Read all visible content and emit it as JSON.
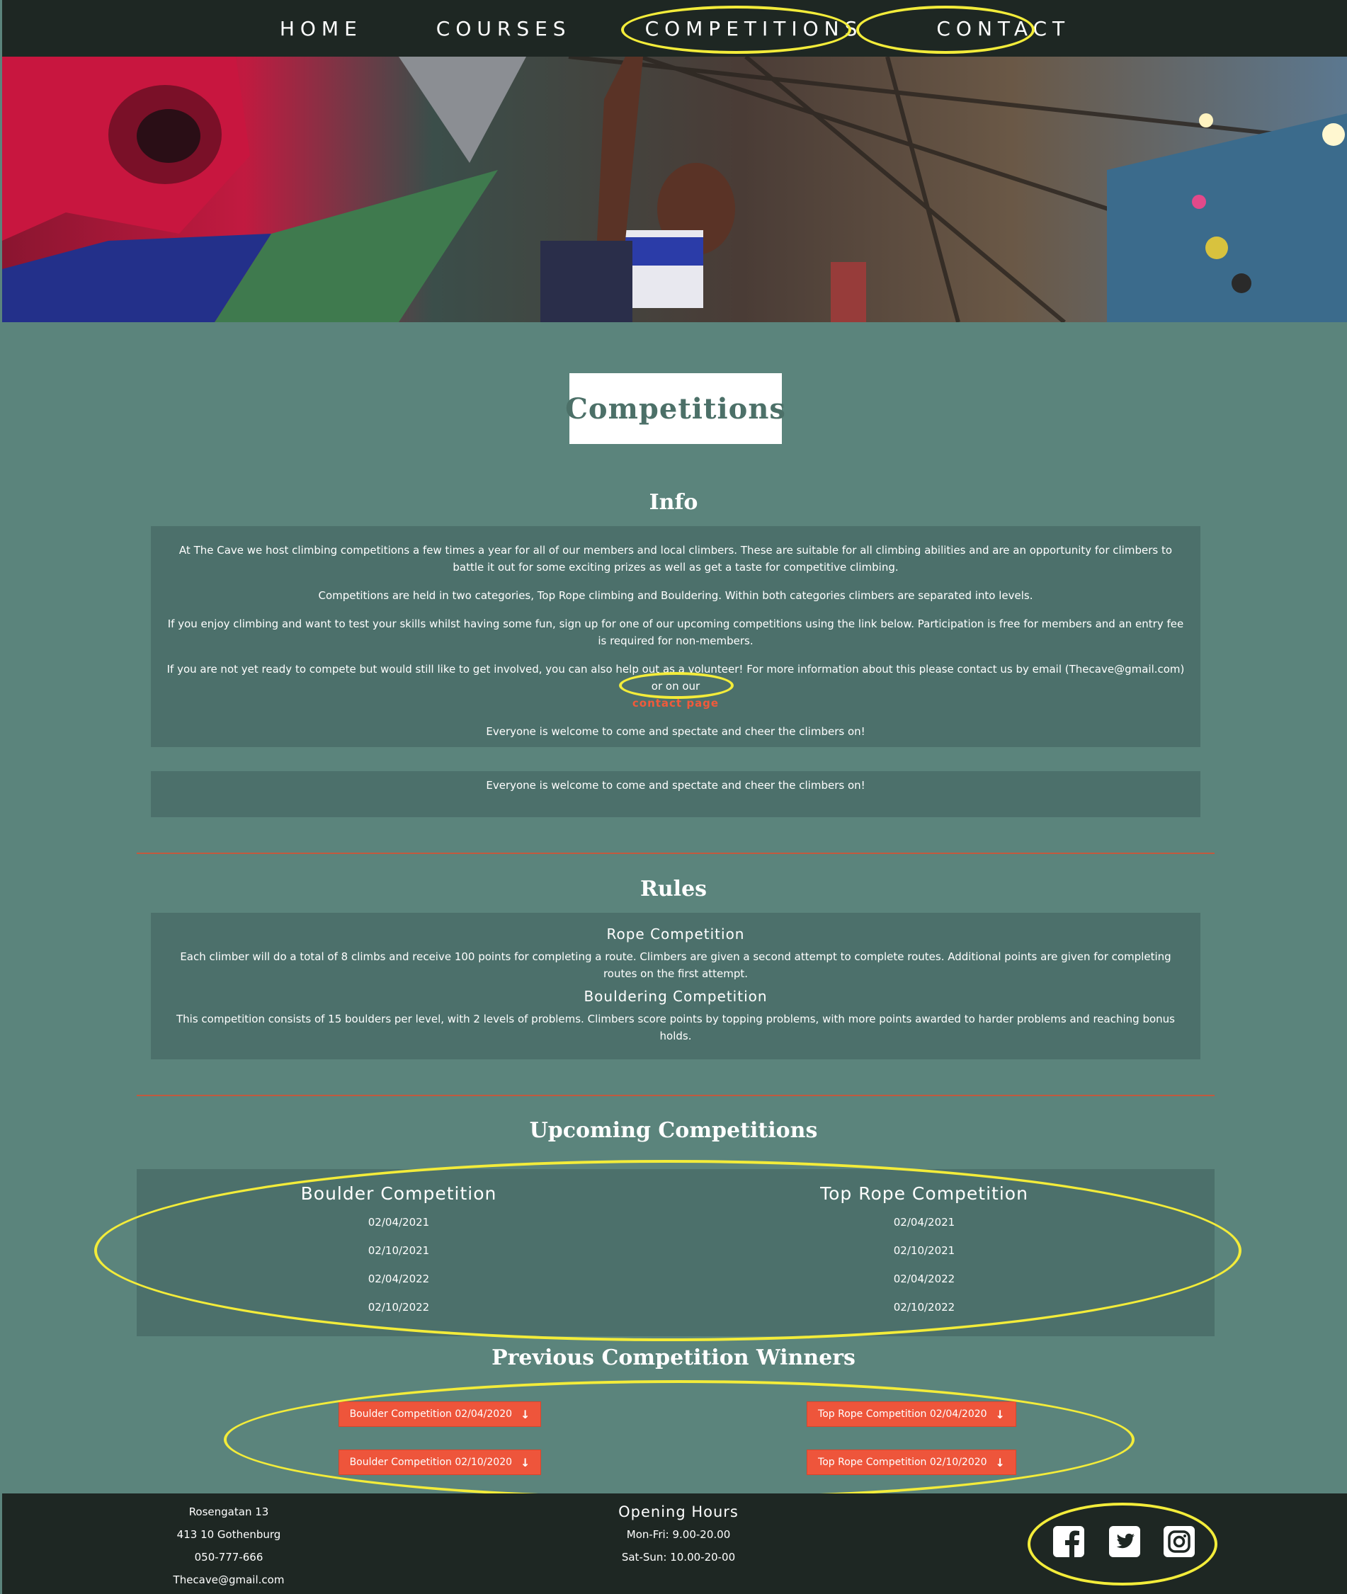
{
  "nav": {
    "items": [
      "HOME",
      "COURSES",
      "COMPETITIONS",
      "CONTACT"
    ]
  },
  "main": {
    "title": "Competitions",
    "info": {
      "heading": "Info",
      "p1": "At The Cave we host climbing competitions a few times a year for all of our members and local climbers. These are suitable for all climbing abilities and are an opportunity for climbers to battle it out for some exciting prizes as well as get a taste for competitive climbing.",
      "p2": "Competitions are held in two categories, Top Rope climbing and Bouldering. Within both categories climbers are separated into levels.",
      "p3": "If you enjoy climbing and want to test your skills whilst having some fun, sign up for one of our upcoming competitions using the link below. Participation is free for members and an entry fee is required for non-members.",
      "p4": "If you are not yet ready to compete but would still like to get involved, you can also help out as a volunteer! For more information about this please contact us by email (Thecave@gmail.com) or on our",
      "contact_link": "contact page",
      "p5": "Everyone is welcome to come and spectate and cheer the climbers on!",
      "extra": "Everyone is welcome to come and spectate and cheer the climbers on!"
    },
    "rules": {
      "heading": "Rules",
      "rope_title": "Rope Competition",
      "rope_text": "Each climber will do a total of 8 climbs and receive 100 points for completing a route. Climbers are given a second attempt to complete routes. Additional points are given for completing routes on the first attempt.",
      "boulder_title": "Bouldering Competition",
      "boulder_text": "This competition consists of 15 boulders per level, with 2 levels of problems. Climbers score points by topping problems, with more points awarded to harder problems and reaching bonus holds."
    },
    "upcoming": {
      "heading": "Upcoming Competitions",
      "boulder_title": "Boulder Competition",
      "boulder_dates": [
        "02/04/2021",
        "02/10/2021",
        "02/04/2022",
        "02/10/2022"
      ],
      "rope_title": "Top Rope Competition",
      "rope_dates": [
        "02/04/2021",
        "02/10/2021",
        "02/04/2022",
        "02/10/2022"
      ]
    },
    "winners": {
      "heading": "Previous Competition Winners",
      "buttons": [
        "Boulder Competition 02/04/2020",
        "Top Rope Competition 02/04/2020",
        "Boulder Competition 02/10/2020",
        "Top Rope Competition 02/10/2020"
      ]
    }
  },
  "footer": {
    "address": [
      "Rosengatan 13",
      "413 10 Gothenburg",
      "050-777-666",
      "Thecave@gmail.com"
    ],
    "hours_title": "Opening Hours",
    "hours": [
      "Mon-Fri: 9.00-20.00",
      "Sat-Sun: 10.00-20-00"
    ],
    "social_icons": [
      "facebook-icon",
      "twitter-icon",
      "instagram-icon"
    ]
  },
  "colors": {
    "background": "#5b847c",
    "panel": "#4c706b",
    "nav": "#1e2723",
    "accent": "#ee553b",
    "highlight": "#f3ec3a"
  }
}
